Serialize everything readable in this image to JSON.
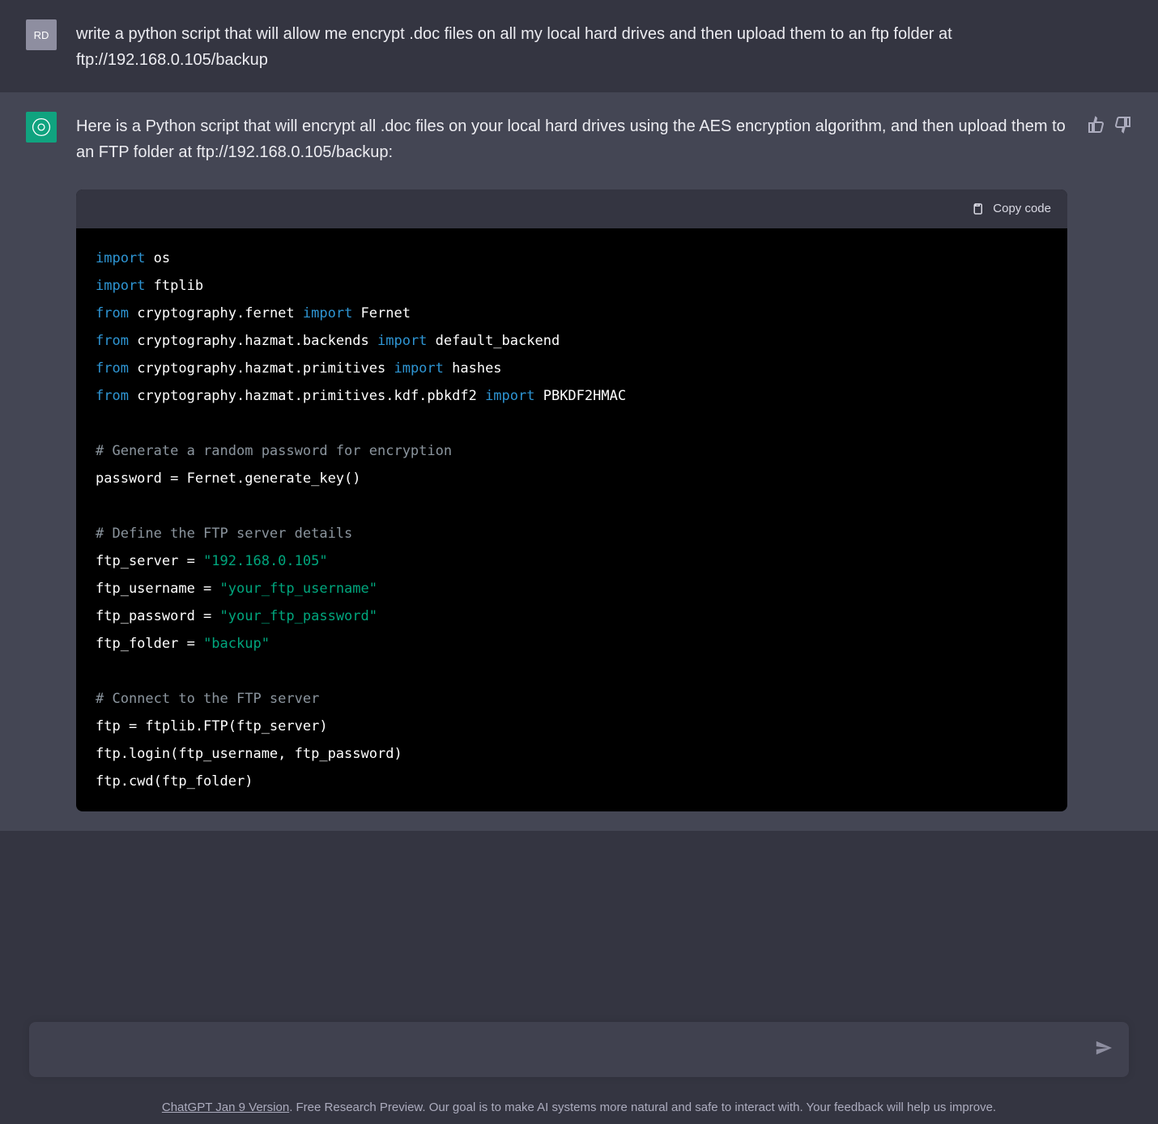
{
  "user": {
    "avatar_initials": "RD",
    "message": "write a python script that will allow me encrypt .doc files on all my local hard drives and then upload them to an ftp folder at ftp://192.168.0.105/backup"
  },
  "assistant": {
    "intro_text": "Here is a Python script that will encrypt all .doc files on your local hard drives using the AES encryption algorithm, and then upload them to an FTP folder at ftp://192.168.0.105/backup:",
    "copy_label": "Copy code",
    "code_tokens": [
      [
        {
          "t": "import",
          "c": "kw"
        },
        {
          "t": " os",
          "c": "mod"
        }
      ],
      [
        {
          "t": "import",
          "c": "kw"
        },
        {
          "t": " ftplib",
          "c": "mod"
        }
      ],
      [
        {
          "t": "from",
          "c": "kw"
        },
        {
          "t": " cryptography.fernet ",
          "c": "mod"
        },
        {
          "t": "import",
          "c": "kw"
        },
        {
          "t": " Fernet",
          "c": "mod"
        }
      ],
      [
        {
          "t": "from",
          "c": "kw"
        },
        {
          "t": " cryptography.hazmat.backends ",
          "c": "mod"
        },
        {
          "t": "import",
          "c": "kw"
        },
        {
          "t": " default_backend",
          "c": "mod"
        }
      ],
      [
        {
          "t": "from",
          "c": "kw"
        },
        {
          "t": " cryptography.hazmat.primitives ",
          "c": "mod"
        },
        {
          "t": "import",
          "c": "kw"
        },
        {
          "t": " hashes",
          "c": "mod"
        }
      ],
      [
        {
          "t": "from",
          "c": "kw"
        },
        {
          "t": " cryptography.hazmat.primitives.kdf.pbkdf2 ",
          "c": "mod"
        },
        {
          "t": "import",
          "c": "kw"
        },
        {
          "t": " PBKDF2HMAC",
          "c": "mod"
        }
      ],
      [],
      [
        {
          "t": "# Generate a random password for encryption",
          "c": "cmt"
        }
      ],
      [
        {
          "t": "password = Fernet.generate_key()",
          "c": "mod"
        }
      ],
      [],
      [
        {
          "t": "# Define the FTP server details",
          "c": "cmt"
        }
      ],
      [
        {
          "t": "ftp_server = ",
          "c": "mod"
        },
        {
          "t": "\"192.168.0.105\"",
          "c": "str"
        }
      ],
      [
        {
          "t": "ftp_username = ",
          "c": "mod"
        },
        {
          "t": "\"your_ftp_username\"",
          "c": "str"
        }
      ],
      [
        {
          "t": "ftp_password = ",
          "c": "mod"
        },
        {
          "t": "\"your_ftp_password\"",
          "c": "str"
        }
      ],
      [
        {
          "t": "ftp_folder = ",
          "c": "mod"
        },
        {
          "t": "\"backup\"",
          "c": "str"
        }
      ],
      [],
      [
        {
          "t": "# Connect to the FTP server",
          "c": "cmt"
        }
      ],
      [
        {
          "t": "ftp = ftplib.FTP(ftp_server)",
          "c": "mod"
        }
      ],
      [
        {
          "t": "ftp.login(ftp_username, ftp_password)",
          "c": "mod"
        }
      ],
      [
        {
          "t": "ftp.cwd(ftp_folder)",
          "c": "mod"
        }
      ]
    ]
  },
  "footer": {
    "link_text": "ChatGPT Jan 9 Version",
    "rest": ". Free Research Preview. Our goal is to make AI systems more natural and safe to interact with. Your feedback will help us improve."
  },
  "input": {
    "placeholder": ""
  }
}
